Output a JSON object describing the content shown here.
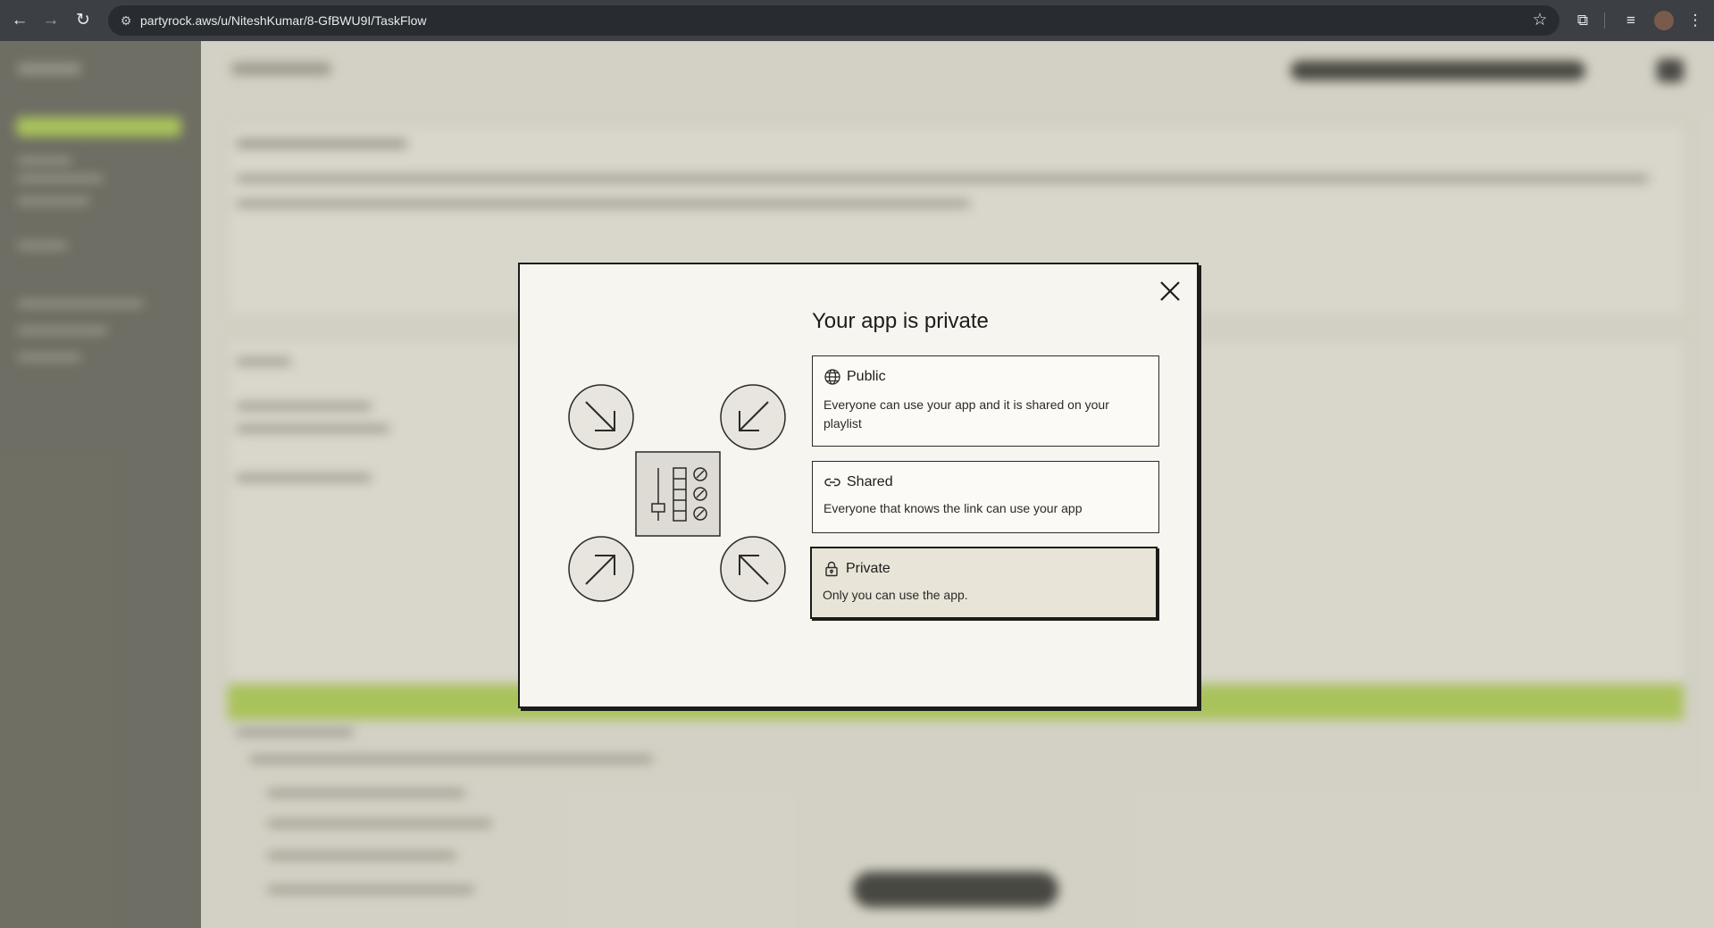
{
  "browser": {
    "url": "partyrock.aws/u/NiteshKumar/8-GfBWU9I/TaskFlow",
    "back_icon": "←",
    "forward_icon": "→",
    "reload_icon": "↻",
    "site_info_icon": "⚙",
    "bookmark_icon": "☆",
    "extensions_icon": "⧉",
    "media_icon": "≡",
    "menu_icon": "⋮"
  },
  "modal": {
    "title": "Your app is private",
    "options": [
      {
        "label": "Public",
        "description": "Everyone can use your app and it is shared on your playlist",
        "icon": "globe-icon",
        "selected": false
      },
      {
        "label": "Shared",
        "description": "Everyone that knows the link can use your app",
        "icon": "link-icon",
        "selected": false
      },
      {
        "label": "Private",
        "description": "Only you can use the app.",
        "icon": "lock-icon",
        "selected": true
      }
    ]
  },
  "colors": {
    "accent_green": "#b9d661",
    "modal_background": "#f7f5f0",
    "selected_option": "#e8e4d8",
    "border": "#1c1c1a"
  }
}
